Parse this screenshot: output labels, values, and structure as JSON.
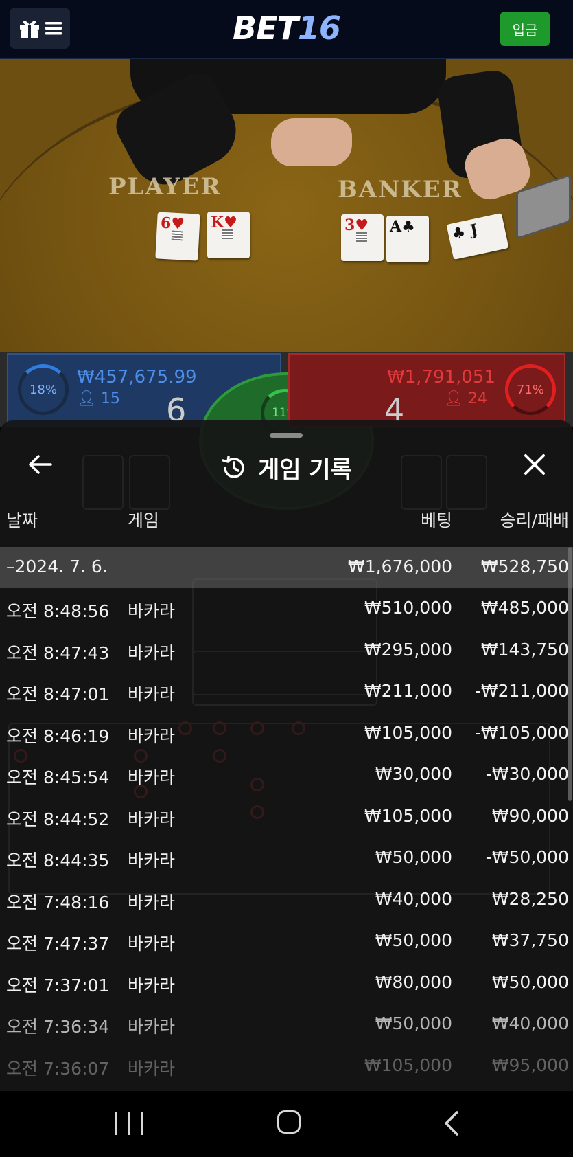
{
  "header": {
    "logo_main": "BET",
    "logo_num": "16",
    "deposit_label": "입금"
  },
  "table": {
    "player_label": "PLAYER",
    "banker_label": "BANKER",
    "player_cards": [
      {
        "rank": "6",
        "suit": "♥",
        "color": "red"
      },
      {
        "rank": "K",
        "suit": "♥",
        "color": "red"
      }
    ],
    "banker_cards": [
      {
        "rank": "3",
        "suit": "♥",
        "color": "red"
      },
      {
        "rank": "A",
        "suit": "♣",
        "color": "black"
      },
      {
        "rank": "J",
        "suit": "♣",
        "color": "black"
      }
    ]
  },
  "bets": {
    "player_percent": "18%",
    "player_amount": "₩457,675.99",
    "player_count": "15",
    "player_score": "6",
    "tie_percent": "11%",
    "banker_percent": "71%",
    "banker_amount": "₩1,791,051",
    "banker_count": "24",
    "banker_score": "4"
  },
  "history": {
    "title": "게임 기록",
    "columns": {
      "date": "날짜",
      "game": "게임",
      "bet": "베팅",
      "winloss": "승리/패배"
    },
    "summary": {
      "date": "–2024. 7. 6.",
      "bet": "₩1,676,000",
      "winloss": "₩528,750"
    },
    "rows": [
      {
        "time": "오전 8:48:56",
        "game": "바카라",
        "bet": "₩510,000",
        "winloss": "₩485,000"
      },
      {
        "time": "오전 8:47:43",
        "game": "바카라",
        "bet": "₩295,000",
        "winloss": "₩143,750"
      },
      {
        "time": "오전 8:47:01",
        "game": "바카라",
        "bet": "₩211,000",
        "winloss": "-₩211,000"
      },
      {
        "time": "오전 8:46:19",
        "game": "바카라",
        "bet": "₩105,000",
        "winloss": "-₩105,000"
      },
      {
        "time": "오전 8:45:54",
        "game": "바카라",
        "bet": "₩30,000",
        "winloss": "-₩30,000"
      },
      {
        "time": "오전 8:44:52",
        "game": "바카라",
        "bet": "₩105,000",
        "winloss": "₩90,000"
      },
      {
        "time": "오전 8:44:35",
        "game": "바카라",
        "bet": "₩50,000",
        "winloss": "-₩50,000"
      },
      {
        "time": "오전 7:48:16",
        "game": "바카라",
        "bet": "₩40,000",
        "winloss": "₩28,250"
      },
      {
        "time": "오전 7:47:37",
        "game": "바카라",
        "bet": "₩50,000",
        "winloss": "₩37,750"
      },
      {
        "time": "오전 7:37:01",
        "game": "바카라",
        "bet": "₩80,000",
        "winloss": "₩50,000"
      },
      {
        "time": "오전 7:36:34",
        "game": "바카라",
        "bet": "₩50,000",
        "winloss": "₩40,000"
      },
      {
        "time": "오전 7:36:07",
        "game": "바카라",
        "bet": "₩105,000",
        "winloss": "₩95,000"
      }
    ]
  },
  "colors": {
    "deposit_green": "#1e9a2c",
    "player_blue": "#4d8fe8",
    "banker_red": "#e23a3a",
    "tie_green": "#36c24a"
  }
}
